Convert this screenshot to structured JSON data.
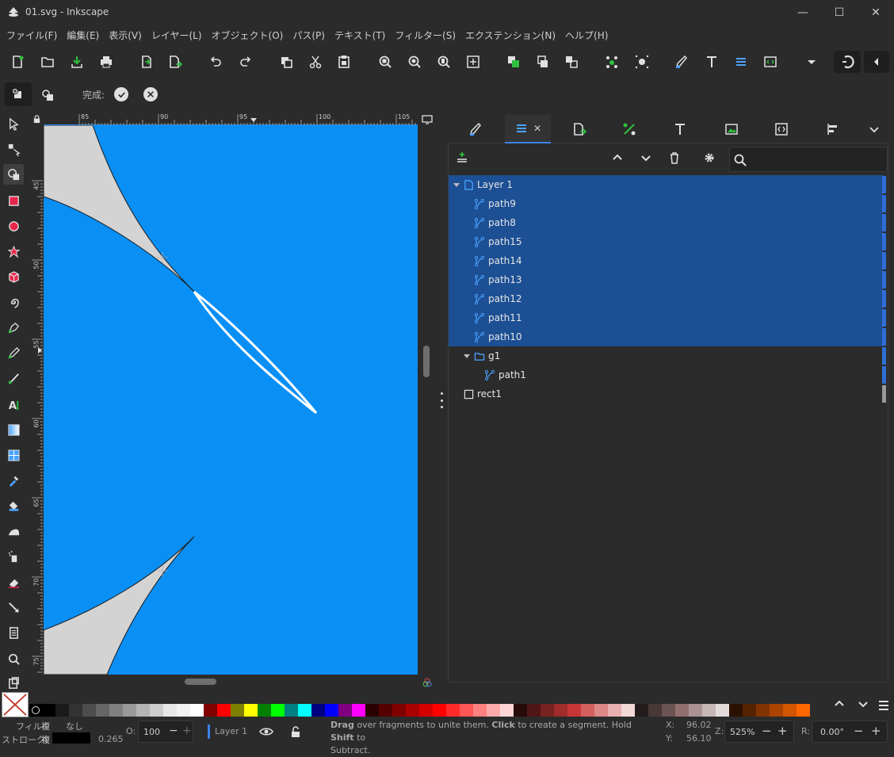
{
  "window": {
    "title": "01.svg - Inkscape",
    "minimize": "—",
    "maximize": "☐",
    "close": "✕"
  },
  "menu": [
    "ファイル(F)",
    "編集(E)",
    "表示(V)",
    "レイヤー(L)",
    "オブジェクト(O)",
    "パス(P)",
    "テキスト(T)",
    "フィルター(S)",
    "エクステンション(N)",
    "ヘルプ(H)"
  ],
  "toolctrl": {
    "done_label": "完成:"
  },
  "rulers": {
    "h_ticks": [
      "85",
      "90",
      "95",
      "100",
      "105"
    ],
    "v_ticks": [
      "45",
      "50",
      "55",
      "60",
      "65",
      "70",
      "75"
    ]
  },
  "panel": {
    "tab_close": "✕",
    "layers": [
      {
        "label": "Layer 1",
        "type": "layer",
        "selected": true,
        "indent": 0
      },
      {
        "label": "path9",
        "type": "path",
        "selected": true,
        "indent": 1
      },
      {
        "label": "path8",
        "type": "path",
        "selected": true,
        "indent": 1
      },
      {
        "label": "path15",
        "type": "path",
        "selected": true,
        "indent": 1
      },
      {
        "label": "path14",
        "type": "path",
        "selected": true,
        "indent": 1
      },
      {
        "label": "path13",
        "type": "path",
        "selected": true,
        "indent": 1
      },
      {
        "label": "path12",
        "type": "path",
        "selected": true,
        "indent": 1
      },
      {
        "label": "path11",
        "type": "path",
        "selected": true,
        "indent": 1
      },
      {
        "label": "path10",
        "type": "path",
        "selected": true,
        "indent": 1
      },
      {
        "label": "g1",
        "type": "group",
        "selected": false,
        "indent": 1
      },
      {
        "label": "path1",
        "type": "path",
        "selected": false,
        "indent": 2
      },
      {
        "label": "rect1",
        "type": "rect",
        "selected": false,
        "indent": 0
      }
    ]
  },
  "status": {
    "fill_label": "フィル:",
    "fill_value": "複",
    "fill_none": "なし",
    "stroke_label": "ストローク:",
    "stroke_value": "複",
    "stroke_width": "0.265",
    "opacity_label": "O:",
    "opacity_value": "100",
    "layer_name": "Layer 1",
    "message_1a": "Drag",
    "message_1b": " over fragments to unite them. ",
    "message_1c": "Click",
    "message_1d": " to create a segment. Hold ",
    "message_1e": "Shift",
    "message_1f": " to",
    "message_2": "Subtract.",
    "x_label": "X:",
    "x_value": "96.02",
    "y_label": "Y:",
    "y_value": "56.10",
    "z_label": "Z:",
    "zoom_value": "525%",
    "r_label": "R:",
    "rotation_value": "0.00°"
  },
  "colors": {
    "canvas_bg": "#0a8ff5",
    "selection": "#1c4f94",
    "shape_fill": "#d3d3d3",
    "accent_green": "#2fbf3f"
  },
  "palette": [
    "#000000",
    "#1a1a1a",
    "#333333",
    "#4d4d4d",
    "#666666",
    "#808080",
    "#999999",
    "#b3b3b3",
    "#cccccc",
    "#e6e6e6",
    "#f2f2f2",
    "#ffffff",
    "#800000",
    "#ff0000",
    "#808000",
    "#ffff00",
    "#008000",
    "#00ff00",
    "#008080",
    "#00ffff",
    "#000080",
    "#0000ff",
    "#800080",
    "#ff00ff",
    "#2b0000",
    "#550000",
    "#800000",
    "#aa0000",
    "#d40000",
    "#ff0000",
    "#ff2a2a",
    "#ff5555",
    "#ff8080",
    "#ffaaaa",
    "#ffd5d5",
    "#280b0b",
    "#501616",
    "#782121",
    "#a02c2c",
    "#c83737",
    "#d35f5f",
    "#de8787",
    "#e9afaf",
    "#f4d7d7",
    "#241c1c",
    "#483737",
    "#6c5353",
    "#916f6f",
    "#ac9393",
    "#c8b7b7",
    "#e3dbdb",
    "#2b1100",
    "#552200",
    "#803300",
    "#aa4400",
    "#d45500",
    "#ff6600"
  ]
}
